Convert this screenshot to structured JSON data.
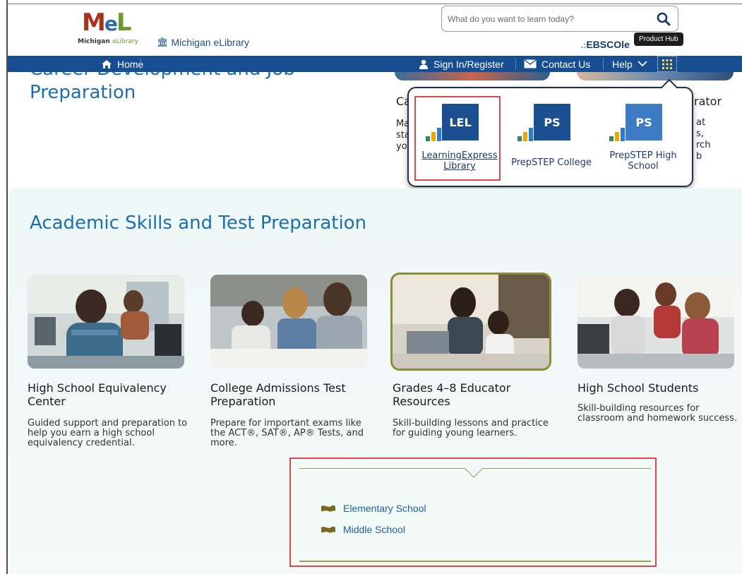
{
  "header": {
    "logo_mark": "MeL",
    "logo_sub_main": "Michigan",
    "logo_sub_accent": "eLibrary",
    "site_link": "Michigan eLibrary",
    "search_placeholder": "What do you want to learn today?",
    "partner": "EBSCOle",
    "tooltip": "Product Hub"
  },
  "nav": {
    "home": "Home",
    "sign_in": "Sign In/Register",
    "contact": "Contact Us",
    "help": "Help"
  },
  "upper": {
    "career_title": "Career Development and Job Preparation",
    "peek_left_title": "Ca",
    "peek_left_lines": [
      "Ma",
      "sta",
      "yo"
    ],
    "peek_right_title": "rator",
    "peek_right_lines": [
      "at",
      "s,",
      "rch",
      "b"
    ]
  },
  "product_hub": {
    "products": [
      {
        "tile": "LEL",
        "label": "LearningExpress Library",
        "color": "#1b4f8f"
      },
      {
        "tile": "PS",
        "label": "PrepSTEP College",
        "color": "#1b4f8f"
      },
      {
        "tile": "PS",
        "label": "PrepSTEP High School",
        "color": "#3d7bc4"
      }
    ]
  },
  "academic": {
    "title": "Academic Skills and Test Preparation",
    "cards": [
      {
        "title": "High School Equivalency Center",
        "desc": "Guided support and preparation to help you earn a high school equivalency credential."
      },
      {
        "title": "College Admissions Test Preparation",
        "desc": "Prepare for important exams like the ACT®, SAT®, AP® Tests, and more."
      },
      {
        "title": "Grades 4–8 Educator Resources",
        "desc": "Skill-building lessons and practice for guiding young learners."
      },
      {
        "title": "High School Students",
        "desc": "Skill-building resources for classroom and homework success."
      }
    ],
    "dropdown": [
      "Elementary School",
      "Middle School"
    ]
  }
}
